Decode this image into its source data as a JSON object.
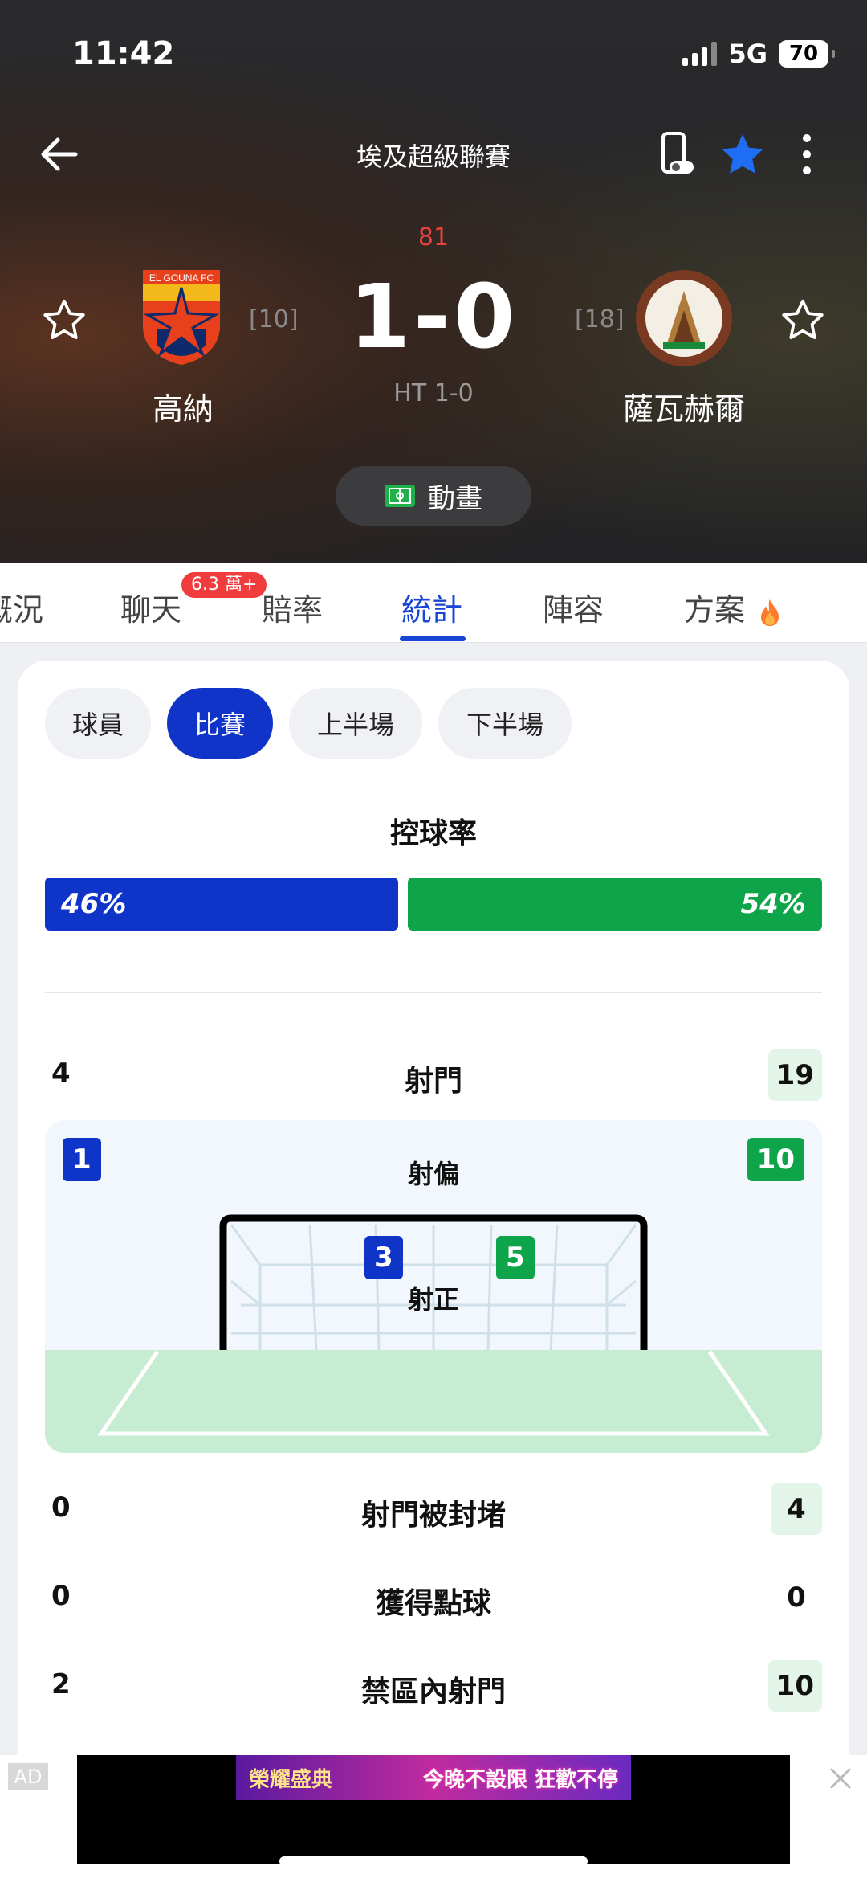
{
  "status": {
    "time": "11:42",
    "network": "5G",
    "battery": "70"
  },
  "header": {
    "league": "埃及超級聯賽",
    "minute": "81",
    "score": "1-0",
    "ht": "HT 1-0"
  },
  "home": {
    "name": "高納",
    "rank": "[10]",
    "logo_text": "EL GOUNA FC"
  },
  "away": {
    "name": "薩瓦赫爾",
    "rank": "[18]"
  },
  "animation_label": "動畫",
  "tabs": [
    {
      "label": "概況"
    },
    {
      "label": "聊天",
      "badge": "6.3 萬+"
    },
    {
      "label": "賠率"
    },
    {
      "label": "統計"
    },
    {
      "label": "陣容"
    },
    {
      "label": "方案"
    }
  ],
  "filters": [
    "球員",
    "比賽",
    "上半場",
    "下半場"
  ],
  "possession": {
    "title": "控球率",
    "home": "46%",
    "away": "54%",
    "home_value": 46,
    "away_value": 54
  },
  "shots": {
    "label": "射門",
    "home": "4",
    "away": "19"
  },
  "shots_off": {
    "label": "射偏",
    "home": "1",
    "away": "10"
  },
  "shots_on": {
    "label": "射正",
    "home": "3",
    "away": "5"
  },
  "stats": [
    {
      "label": "射門被封堵",
      "home": "0",
      "away": "4"
    },
    {
      "label": "獲得點球",
      "home": "0",
      "away": "0"
    },
    {
      "label": "禁區內射門",
      "home": "2",
      "away": "10"
    }
  ],
  "ad": {
    "tag": "AD",
    "left_text": "榮耀盛典",
    "right_text": "今晚不設限 狂歡不停"
  },
  "colors": {
    "home": "#0f34c8",
    "away": "#0ea54a",
    "accent": "#1746d6",
    "live": "#e8403c"
  }
}
